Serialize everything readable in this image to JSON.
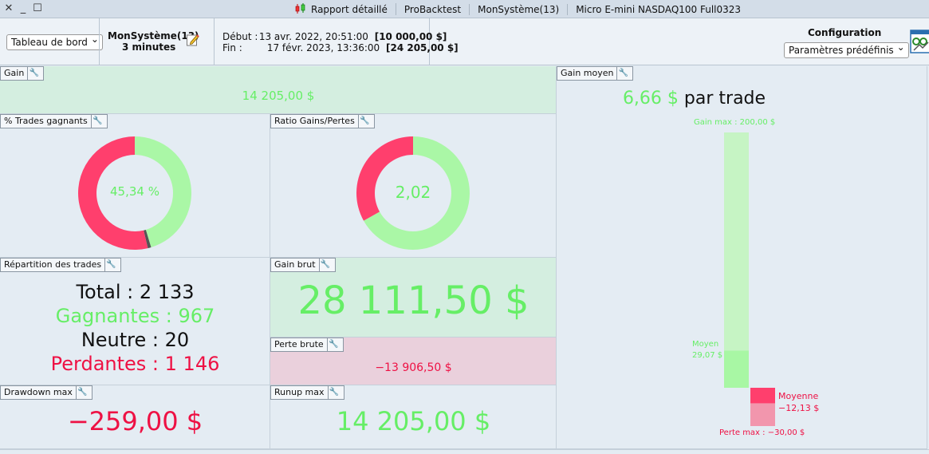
{
  "titlebar": {
    "items": [
      "Rapport détaillé",
      "ProBacktest",
      "MonSystème(13)",
      "Micro E-mini NASDAQ100 Full0323"
    ]
  },
  "toolbar": {
    "view_select": "Tableau de bord",
    "system_name": "MonSystème(13)",
    "timeframe": "3 minutes",
    "start_label": "Début :",
    "start_value": "13 avr. 2022, 20:51:00",
    "start_capital": "[10 000,00 $]",
    "end_label": "Fin :",
    "end_value": "17 févr. 2023, 13:36:00",
    "end_capital": "[24 205,00 $]",
    "config_title": "Configuration",
    "config_select": "Paramètres prédéfinis"
  },
  "panels": {
    "gain": {
      "title": "Gain",
      "value": "14 205,00 $"
    },
    "win_pct": {
      "title": "% Trades gagnants",
      "value": "45,34 %",
      "win_fraction": 0.4534,
      "neutral_fraction": 0.0094
    },
    "ratio": {
      "title": "Ratio Gains/Pertes",
      "value": "2,02",
      "gain_fraction": 0.669
    },
    "distribution": {
      "title": "Répartition des trades",
      "total_label": "Total : 2 133",
      "win_label": "Gagnantes : 967",
      "neutral_label": "Neutre : 20",
      "loss_label": "Perdantes : 1 146"
    },
    "gross_gain": {
      "title": "Gain brut",
      "value": "28 111,50 $"
    },
    "gross_loss": {
      "title": "Perte brute",
      "value": "−13 906,50 $"
    },
    "drawdown": {
      "title": "Drawdown max",
      "value": "−259,00 $"
    },
    "runup": {
      "title": "Runup max",
      "value": "14 205,00 $"
    },
    "avg_gain": {
      "title": "Gain moyen",
      "value": "6,66 $",
      "suffix": " par trade",
      "max_gain_label": "Gain max : 200,00 $",
      "avg_label": "Moyen",
      "avg_value": "29,07 $",
      "avg_loss_label": "Moyenne",
      "avg_loss_value": "−12,13 $",
      "max_loss_label": "Perte max : −30,00 $",
      "max_gain": 200.0,
      "avg_win": 29.07,
      "avg_loss": -12.13,
      "max_loss": -30.0
    }
  },
  "colors": {
    "green": "#aaf7a6",
    "green_text": "#66ee66",
    "red": "#ff3f6d",
    "red_text": "#ee1144",
    "light_green_panel": "#d4eee0",
    "light_red_panel": "#ead0dc"
  }
}
